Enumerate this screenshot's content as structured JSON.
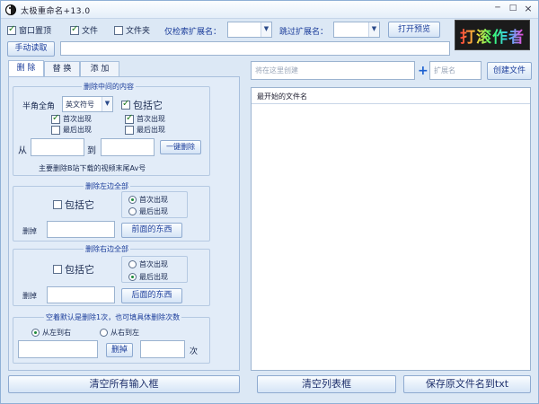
{
  "window": {
    "title": "太极重命名+13.0",
    "minimize": "─",
    "maximize": "□",
    "close": "×"
  },
  "toolbar": {
    "pin_label": "窗口置顶",
    "pin_checked": true,
    "file_label": "文件",
    "file_checked": true,
    "folder_label": "文件夹",
    "folder_checked": false,
    "only_ext_label": "仅检索扩展名：",
    "skip_ext_label": "跳过扩展名：",
    "only_ext_value": "",
    "skip_ext_value": "",
    "preview_button": "打开预览",
    "manual_read_button": "手动读取",
    "path_value": ""
  },
  "logo": {
    "text": "打滚作者"
  },
  "tabs": [
    "删 除",
    "替 换",
    "添 加"
  ],
  "delete_middle": {
    "legend": "删除中间的内容",
    "width_label": "半角全角",
    "width_value": "英文符号",
    "include_label": "包括它",
    "include_checked": true,
    "left_first_label": "首次出现",
    "left_first_checked": true,
    "left_last_label": "最后出现",
    "left_last_checked": false,
    "right_first_label": "首次出现",
    "right_first_checked": true,
    "right_last_label": "最后出现",
    "right_last_checked": false,
    "from_label": "从",
    "to_label": "到",
    "from_value": "",
    "to_value": "",
    "delete_button": "一键删除",
    "note": "主要删除B站下载的视频末尾Av号"
  },
  "delete_left": {
    "legend": "删除左边全部",
    "include_label": "包括它",
    "include_checked": false,
    "first_label": "首次出现",
    "first_selected": true,
    "last_label": "最后出现",
    "last_selected": false,
    "remove_label": "删掉",
    "value": "",
    "button": "前面的东西"
  },
  "delete_right": {
    "legend": "删除右边全部",
    "include_label": "包括它",
    "include_checked": false,
    "first_label": "首次出现",
    "first_selected": false,
    "last_label": "最后出现",
    "last_selected": true,
    "remove_label": "删掉",
    "value": "",
    "button": "后面的东西"
  },
  "delete_count": {
    "legend": "空着默认是删除1次，也可填具体删除次数",
    "ltr_label": "从左到右",
    "ltr_selected": true,
    "rtl_label": "从右到左",
    "rtl_selected": false,
    "text_value": "",
    "button": "删掉",
    "count_value": "",
    "times_label": "次"
  },
  "right_panel": {
    "create_placeholder": "将在这里创建",
    "ext_placeholder": "扩展名",
    "create_button": "创建文件",
    "list_header": "最开始的文件名"
  },
  "bottom": {
    "clear_inputs": "清空所有输入框",
    "clear_list": "清空列表框",
    "save_names": "保存原文件名到txt"
  }
}
